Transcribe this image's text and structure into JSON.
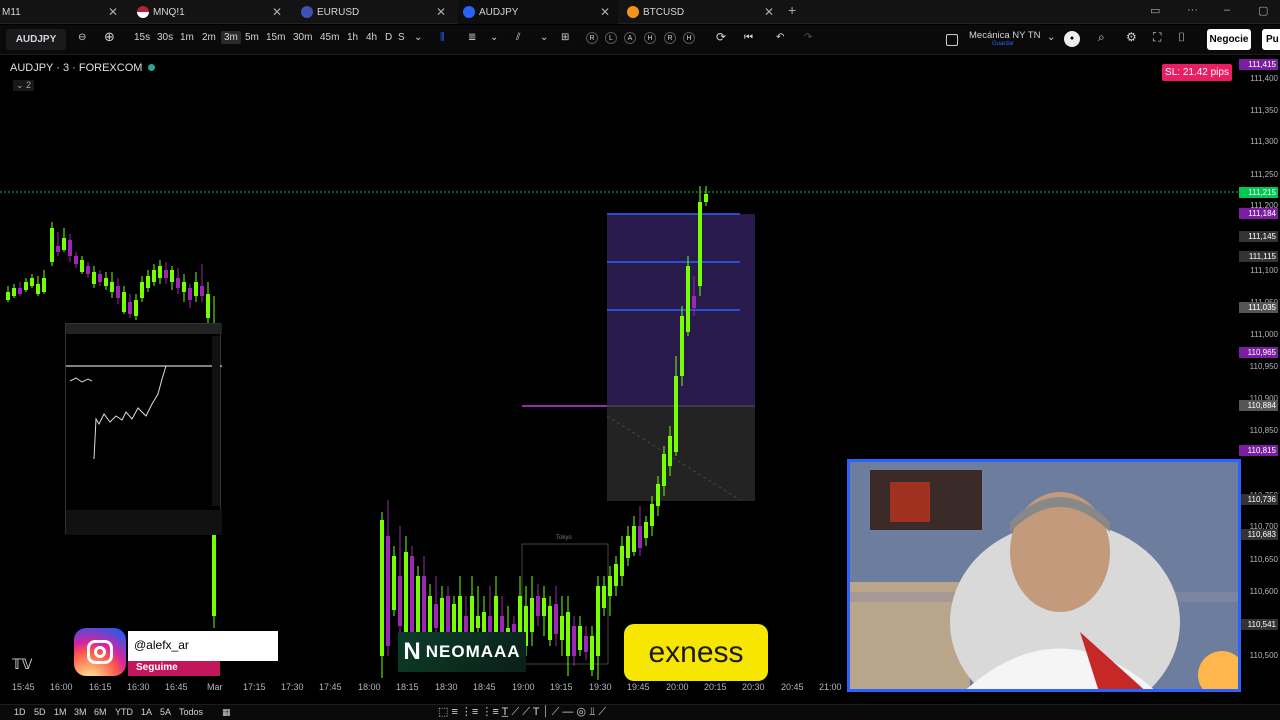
{
  "tabs": [
    {
      "label": "M11",
      "icon": "none",
      "active": false
    },
    {
      "label": "MNQ!1",
      "icon": "us-flag-icon",
      "active": false
    },
    {
      "label": "EURUSD",
      "icon": "currency-pair-icon",
      "active": false
    },
    {
      "label": "AUDJPY",
      "icon": "currency-pair-icon",
      "active": true
    },
    {
      "label": "BTCUSD",
      "icon": "bitcoin-icon",
      "active": false
    }
  ],
  "toolbar": {
    "symbol": "AUDJPY",
    "intervals": [
      "15s",
      "30s",
      "1m",
      "2m",
      "3m",
      "5m",
      "15m",
      "30m",
      "45m",
      "1h",
      "4h",
      "D",
      "S"
    ],
    "selected_interval": "3m",
    "replay_letters": [
      "R",
      "L",
      "A",
      "H",
      "R",
      "H"
    ],
    "layout_name": "Mecánica NY TN",
    "layout_sub": "Guardar",
    "trade_button": "Negocie",
    "publish_button": "Pu"
  },
  "chart": {
    "legend_title": "AUDJPY · 3 · FOREXCOM",
    "legend_sub": "⌄ 2",
    "sl_label": "SL: 21.42 pips",
    "price_labels": [
      "111,400",
      "111,350",
      "111,300",
      "111,250",
      "111,200",
      "111,100",
      "111,050",
      "111,000",
      "110,950",
      "110,900",
      "110,850",
      "110,750",
      "110,700",
      "110,650",
      "110,600",
      "110,550",
      "110,500"
    ],
    "price_tags": [
      {
        "text": "111,415",
        "color": "#7b1fa2"
      },
      {
        "text": "111,215",
        "color": "#00c853"
      },
      {
        "text": "111,184",
        "color": "#7b1fa2"
      },
      {
        "text": "111,145",
        "color": "#333333"
      },
      {
        "text": "111,115",
        "color": "#333333"
      },
      {
        "text": "111,035",
        "color": "#555555"
      },
      {
        "text": "110,965",
        "color": "#7b1fa2"
      },
      {
        "text": "110,884",
        "color": "#555555"
      },
      {
        "text": "110,815",
        "color": "#7b1fa2"
      },
      {
        "text": "110,736",
        "color": "#333333"
      },
      {
        "text": "110,683",
        "color": "#333333"
      },
      {
        "text": "110,541",
        "color": "#333333"
      }
    ],
    "time_labels": [
      "15:45",
      "16:00",
      "16:15",
      "16:30",
      "16:45",
      "Mar",
      "17:15",
      "17:30",
      "17:45",
      "18:00",
      "18:15",
      "18:30",
      "18:45",
      "19:00",
      "19:15",
      "19:30",
      "19:45",
      "20:00",
      "20:15",
      "20:30",
      "20:45",
      "21:00"
    ],
    "tokyo_label": "Tokyo",
    "bull_color": "#76ff03",
    "bear_color": "#9c27b0"
  },
  "bottom": {
    "ranges": [
      "1D",
      "5D",
      "1M",
      "3M",
      "6M",
      "YTD",
      "1A",
      "5A",
      "Todos"
    ]
  },
  "overlays": {
    "instagram_handle": "@alefx_ar",
    "instagram_cta": "Seguime",
    "sponsor1": "NEOMAAA",
    "sponsor2": "exness"
  }
}
